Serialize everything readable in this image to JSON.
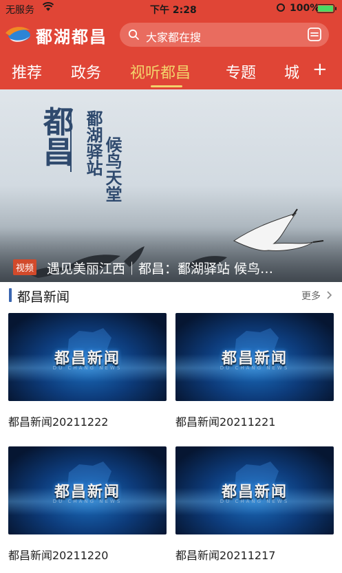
{
  "status_bar": {
    "carrier": "无服务",
    "time": "下午 2:28",
    "battery": "100%",
    "icons": [
      "wifi-icon",
      "orientation-lock-icon",
      "battery-icon"
    ]
  },
  "header": {
    "brand": "鄱湖都昌",
    "search_placeholder": "大家都在搜",
    "accent_color": "#e04536",
    "active_tab_color": "#f3d36c"
  },
  "tabs": [
    {
      "label": "推荐"
    },
    {
      "label": "政务"
    },
    {
      "label": "视听都昌",
      "active": true
    },
    {
      "label": "专题"
    },
    {
      "label": "城"
    }
  ],
  "tab_add": "+",
  "banner": {
    "poster_big": "都昌",
    "poster_mid": "鄱湖驿站",
    "poster_small": "候鸟天堂",
    "badge": "视频",
    "title": "遇见美丽江西｜都昌：鄱湖驿站 候鸟…"
  },
  "section": {
    "title": "都昌新闻",
    "more": "更多"
  },
  "cards": [
    {
      "thumb_title": "都昌新闻",
      "thumb_sub": "DU CHANG NEWS",
      "caption": "都昌新闻20211222"
    },
    {
      "thumb_title": "都昌新闻",
      "thumb_sub": "DU CHANG NEWS",
      "caption": "都昌新闻20211221"
    },
    {
      "thumb_title": "都昌新闻",
      "thumb_sub": "DU CHANG NEWS",
      "caption": "都昌新闻20211220"
    },
    {
      "thumb_title": "都昌新闻",
      "thumb_sub": "DU CHANG NEWS",
      "caption": "都昌新闻20211217"
    }
  ]
}
